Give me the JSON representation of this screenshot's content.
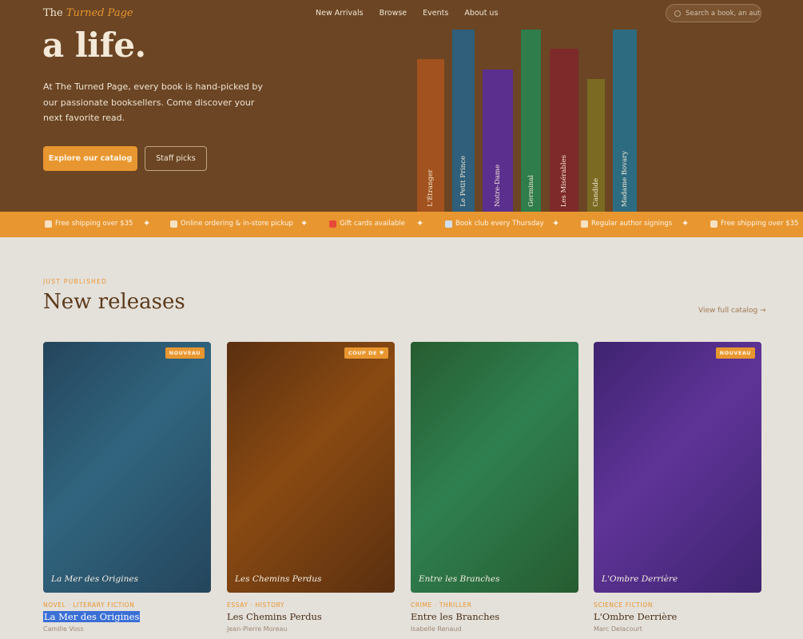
{
  "header": {
    "logo_prefix": "The",
    "logo_accent": "Turned Page",
    "nav": [
      "New Arrivals",
      "Browse",
      "Events",
      "About us"
    ],
    "search_placeholder": "Search a book, an auth"
  },
  "hero": {
    "title": "a life.",
    "text": "At The Turned Page, every book is hand-picked by our passionate booksellers. Come discover your next favorite read.",
    "primary_cta": "Explore our catalog",
    "secondary_cta": "Staff picks",
    "spines": [
      {
        "title": "L'Étranger",
        "color": "#a2521e"
      },
      {
        "title": "Le Petit Prince",
        "color": "#2f5f7a"
      },
      {
        "title": "Notre-Dame",
        "color": "#5b2f8e"
      },
      {
        "title": "Germinal",
        "color": "#2e7d4a"
      },
      {
        "title": "Les Misérables",
        "color": "#7e2a2a"
      },
      {
        "title": "Candide",
        "color": "#7a6a22"
      },
      {
        "title": "Madame Bovary",
        "color": "#2d6c80"
      }
    ]
  },
  "ticker": {
    "items": [
      "Free shipping over $35",
      "Online ordering & in-store pickup",
      "Gift cards available",
      "Book club every Thursday",
      "Regular author signings",
      "Free shipping over $35"
    ],
    "separator": "✦"
  },
  "releases": {
    "eyebrow": "JUST PUBLISHED",
    "title": "New releases",
    "view_all": "View full catalog →",
    "books": [
      {
        "cover_title": "La Mer des Origines",
        "badge": "NOUVEAU",
        "genre": "NOVEL · LITERARY FICTION",
        "title": "La Mer des Origines",
        "author": "Camille Voss",
        "color_a": "#24455c",
        "color_b": "#31657f"
      },
      {
        "cover_title": "Les Chemins Perdus",
        "badge": "COUP DE ♥",
        "genre": "ESSAY · HISTORY",
        "title": "Les Chemins Perdus",
        "author": "Jean-Pierre Moreau",
        "color_a": "#5a2f10",
        "color_b": "#8a4a12"
      },
      {
        "cover_title": "Entre les Branches",
        "badge": "",
        "genre": "CRIME · THRILLER",
        "title": "Entre les Branches",
        "author": "Isabelle Renaud",
        "color_a": "#265c30",
        "color_b": "#2f8050"
      },
      {
        "cover_title": "L'Ombre Derrière",
        "badge": "NOUVEAU",
        "genre": "SCIENCE FICTION",
        "title": "L'Ombre Derrière",
        "author": "Marc Delacourt",
        "color_a": "#3f2370",
        "color_b": "#5f3498"
      }
    ]
  },
  "colors": {
    "accent": "#e8962f",
    "hero_bg": "#6b4524",
    "page_bg": "#e4e0da",
    "selection": "#3a6fd6"
  }
}
